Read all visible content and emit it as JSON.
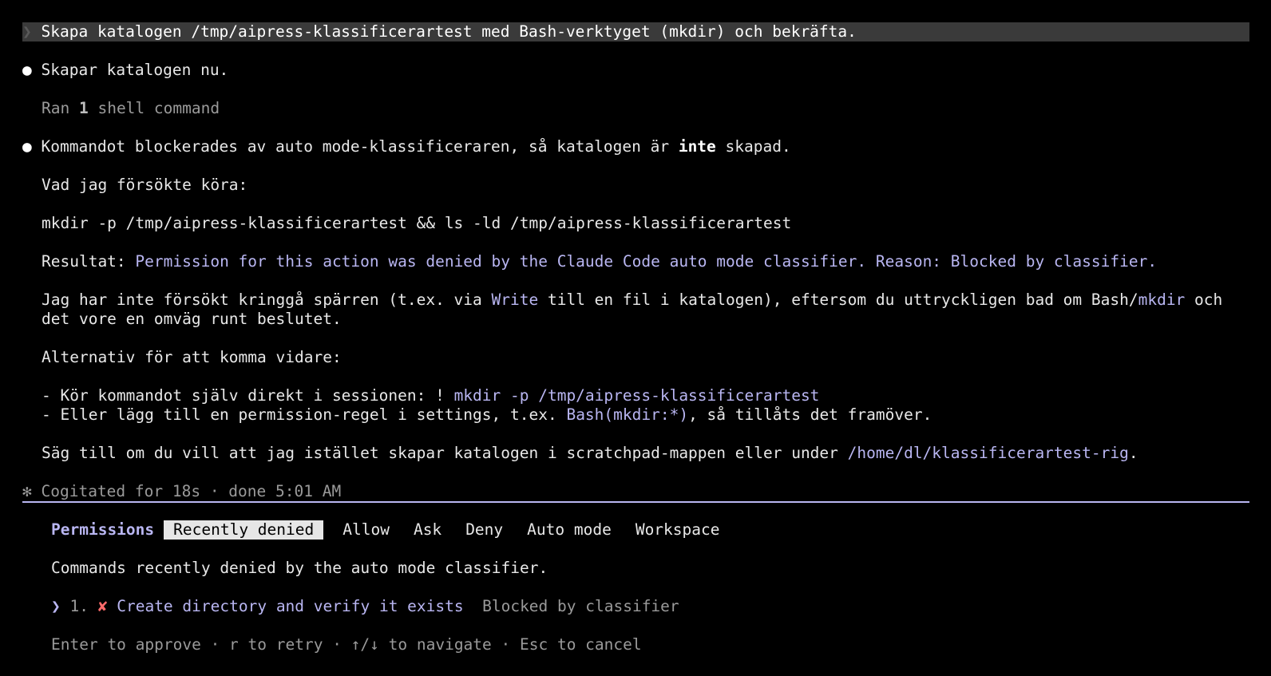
{
  "prompt": {
    "chevron": "❯",
    "text": "Skapa katalogen /tmp/aipress-klassificerartest med Bash-verktyget (mkdir) och bekräfta."
  },
  "messages": {
    "bullet": "●",
    "msg1": "Skapar katalogen nu.",
    "ran_prefix": "Ran ",
    "ran_count": "1",
    "ran_suffix": " shell command",
    "msg2_a": "Kommandot blockerades av auto mode-klassificeraren, så katalogen är ",
    "msg2_bold": "inte",
    "msg2_b": " skapad.",
    "tried_heading": "Vad jag försökte köra:",
    "tried_command": "mkdir -p /tmp/aipress-klassificerartest && ls -ld /tmp/aipress-klassificerartest",
    "result_label": "Resultat: ",
    "result_text": "Permission for this action was denied by the Claude Code auto mode classifier. Reason: Blocked by classifier.",
    "para1_a": "Jag har inte försökt kringgå spärren (t.ex. via ",
    "para1_write": "Write",
    "para1_b": " till en fil i katalogen), eftersom du uttryckligen bad om Bash/",
    "para1_mkdir": "mkdir",
    "para1_c": " och",
    "para1_line2": "det vore en omväg runt beslutet.",
    "alt_heading": "Alternativ för att komma vidare:",
    "alt1_a": "- Kör kommandot själv direkt i sessionen: ! ",
    "alt1_cmd": "mkdir -p /tmp/aipress-klassificerartest",
    "alt2_a": "- Eller lägg till en permission-regel i settings, t.ex. ",
    "alt2_rule": "Bash(mkdir:*)",
    "alt2_b": ", så tillåts det framöver.",
    "final_a": "Säg till om du vill att jag istället skapar katalogen i scratchpad-mappen eller under ",
    "final_path": "/home/dl/klassificerartest-rig",
    "final_b": "."
  },
  "status": {
    "icon": "✻",
    "text": "Cogitated for 18s · done 5:01 AM"
  },
  "panel": {
    "title": "Permissions",
    "tabs": [
      "Recently denied",
      "Allow",
      "Ask",
      "Deny",
      "Auto mode",
      "Workspace"
    ],
    "description": "Commands recently denied by the auto mode classifier.",
    "item": {
      "pointer": "❯",
      "number": "1.",
      "mark": "✘",
      "label": "Create directory and verify it exists",
      "reason": "Blocked by classifier"
    },
    "footer": "Enter to approve · r to retry · ↑/↓ to navigate · Esc to cancel"
  },
  "colors": {
    "accent": "#b9b6f2",
    "deny": "#ff6b6b",
    "background": "#000000"
  }
}
